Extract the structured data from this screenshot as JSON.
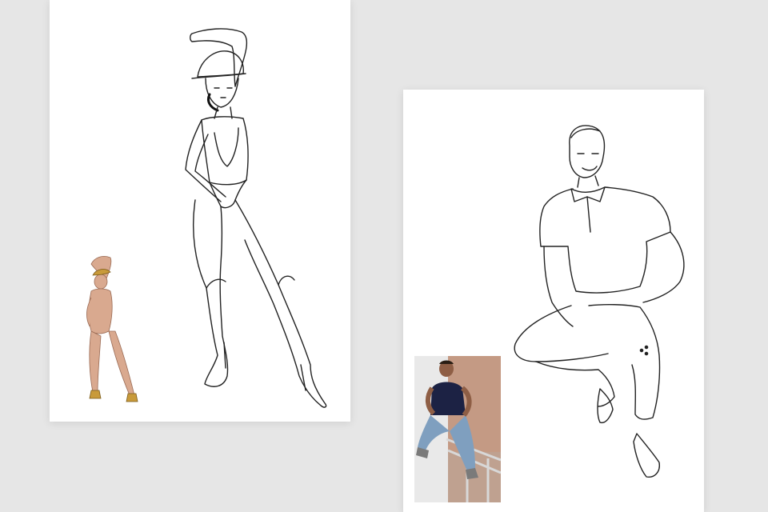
{
  "canvas": {
    "background": "#e6e6e6"
  },
  "cards": [
    {
      "id": "left",
      "sketch": "female-figure-pencil-sketch",
      "reference_photo": "female-model-reference-photo",
      "line_color": "#222222",
      "skin_tone": "#d9a98f"
    },
    {
      "id": "right",
      "sketch": "male-figure-pencil-sketch",
      "reference_photo": "male-model-reference-photo",
      "line_color": "#222222",
      "shirt_color": "#1c2244",
      "jeans_color": "#7f9fbf",
      "wall_color": "#c49a84"
    }
  ]
}
